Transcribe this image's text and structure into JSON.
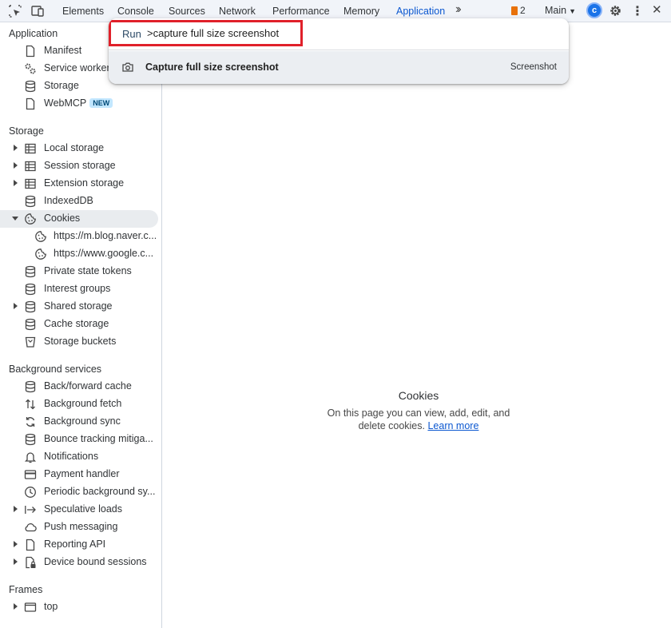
{
  "toolbar": {
    "tabs": [
      "Elements",
      "Console",
      "Sources",
      "Network",
      "Performance",
      "Memory",
      "Application"
    ],
    "active_tab": "Application",
    "issues_count": "2",
    "context": "Main",
    "accent": "#0b57d0"
  },
  "sidebar": {
    "application_heading": "Application",
    "application_items": [
      {
        "label": "Manifest",
        "icon": "document-icon"
      },
      {
        "label": "Service workers",
        "icon": "gears-icon"
      },
      {
        "label": "Storage",
        "icon": "database-icon"
      },
      {
        "label": "WebMCP",
        "icon": "document-icon",
        "badge": "NEW"
      }
    ],
    "storage_heading": "Storage",
    "storage_items": [
      {
        "label": "Local storage",
        "icon": "table-icon",
        "expandable": true
      },
      {
        "label": "Session storage",
        "icon": "table-icon",
        "expandable": true
      },
      {
        "label": "Extension storage",
        "icon": "table-icon",
        "expandable": true
      },
      {
        "label": "IndexedDB",
        "icon": "database-icon"
      },
      {
        "label": "Cookies",
        "icon": "cookie-icon",
        "expanded": true,
        "selected": true
      },
      {
        "label": "https://m.blog.naver.c...",
        "icon": "cookie-icon",
        "child": true
      },
      {
        "label": "https://www.google.c...",
        "icon": "cookie-icon",
        "child": true
      },
      {
        "label": "Private state tokens",
        "icon": "database-icon"
      },
      {
        "label": "Interest groups",
        "icon": "database-icon"
      },
      {
        "label": "Shared storage",
        "icon": "database-icon",
        "expandable": true
      },
      {
        "label": "Cache storage",
        "icon": "database-icon"
      },
      {
        "label": "Storage buckets",
        "icon": "bucket-icon"
      }
    ],
    "background_heading": "Background services",
    "background_items": [
      {
        "label": "Back/forward cache",
        "icon": "database-icon"
      },
      {
        "label": "Background fetch",
        "icon": "arrows-updown-icon"
      },
      {
        "label": "Background sync",
        "icon": "sync-icon"
      },
      {
        "label": "Bounce tracking mitiga...",
        "icon": "database-icon"
      },
      {
        "label": "Notifications",
        "icon": "bell-icon"
      },
      {
        "label": "Payment handler",
        "icon": "card-icon"
      },
      {
        "label": "Periodic background sy...",
        "icon": "clock-icon"
      },
      {
        "label": "Speculative loads",
        "icon": "arrow-bar-icon",
        "expandable": true
      },
      {
        "label": "Push messaging",
        "icon": "cloud-icon"
      },
      {
        "label": "Reporting API",
        "icon": "document-icon",
        "expandable": true
      },
      {
        "label": "Device bound sessions",
        "icon": "lock-doc-icon",
        "expandable": true
      }
    ],
    "frames_heading": "Frames",
    "frames_items": [
      {
        "label": "top",
        "icon": "frame-icon",
        "expandable": true
      }
    ]
  },
  "main": {
    "empty_title": "Cookies",
    "empty_desc_line1": "On this page you can view, add, edit, and",
    "empty_desc_line2": "delete cookies.",
    "empty_link": "Learn more"
  },
  "command_menu": {
    "prefix": "Run",
    "input_value": ">capture full size screenshot",
    "result_label": "Capture full size screenshot",
    "result_category": "Screenshot",
    "highlight_color": "#e0202a"
  }
}
